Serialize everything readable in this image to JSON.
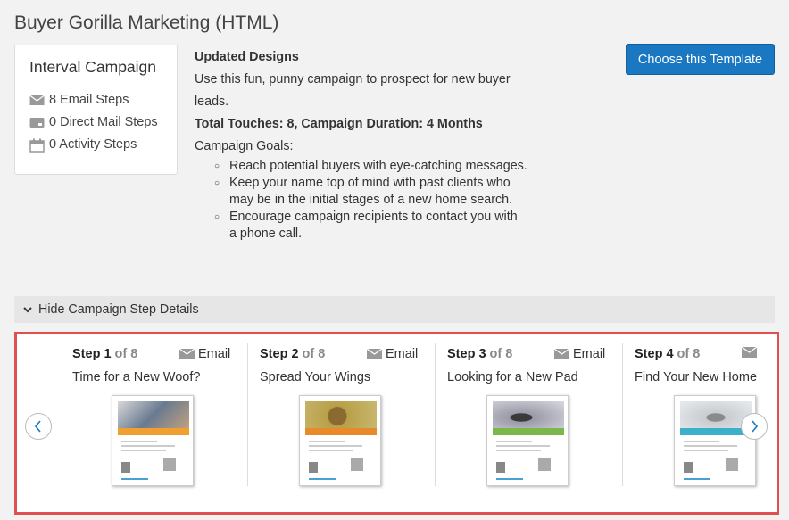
{
  "page": {
    "title": "Buyer Gorilla Marketing (HTML)"
  },
  "summary": {
    "title": "Interval Campaign",
    "email_steps": "8 Email Steps",
    "direct_mail_steps": "0 Direct Mail Steps",
    "activity_steps": "0 Activity Steps"
  },
  "description": {
    "heading": "Updated Designs",
    "intro": "Use this fun, punny campaign to prospect for new buyer leads.",
    "touches": "Total Touches: 8, Campaign Duration: 4 Months",
    "goals_label": "Campaign Goals:",
    "goals": [
      "Reach potential buyers with eye-catching messages.",
      "Keep your name top of mind with past clients who may be in the initial stages of a new home search.",
      "Encourage campaign recipients to contact you with a phone call."
    ]
  },
  "actions": {
    "choose_template": "Choose this Template"
  },
  "toggle": {
    "label": "Hide Campaign Step Details"
  },
  "steps": [
    {
      "label": "Step 1",
      "of": "of 8",
      "type": "Email",
      "name": "Time for a New Woof?",
      "band_color": "#f0a030",
      "img_color": "#7a8ea8"
    },
    {
      "label": "Step 2",
      "of": "of 8",
      "type": "Email",
      "name": "Spread Your Wings",
      "band_color": "#e88a2a",
      "img_color": "#a89040"
    },
    {
      "label": "Step 3",
      "of": "of 8",
      "type": "Email",
      "name": "Looking for a New Pad",
      "band_color": "#7bb84a",
      "img_color": "#8a8a9a"
    },
    {
      "label": "Step 4",
      "of": "of 8",
      "type": "Email",
      "name": "Find Your New Home",
      "band_color": "#3cb0c8",
      "img_color": "#c8ccd0"
    }
  ],
  "colors": {
    "accent": "#1a78c2",
    "highlight_border": "#e05050"
  }
}
